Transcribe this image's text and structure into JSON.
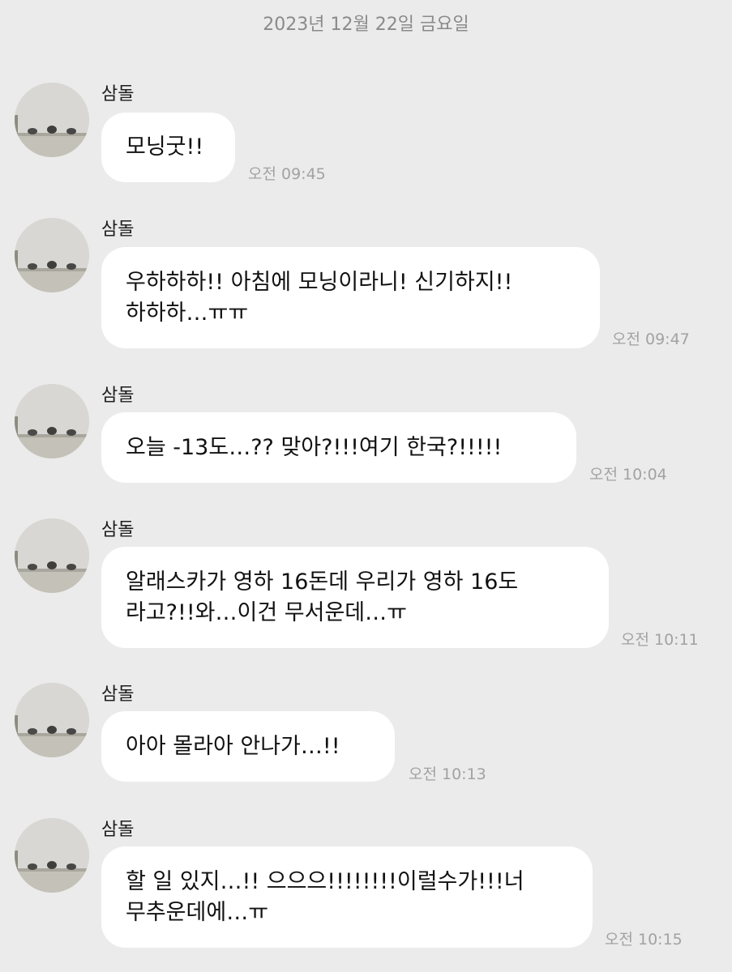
{
  "date_header": "2023년 12월 22일 금요일",
  "sender_name": "삼돌",
  "messages": [
    {
      "text": "모닝굿!!",
      "time": "오전 09:45"
    },
    {
      "text": "우하하하!! 아침에 모닝이라니! 신기하지!!\n하하하…ㅠㅠ",
      "time": "오전 09:47"
    },
    {
      "text": "오늘 -13도…?? 맞아?!!!여기 한국?!!!!!",
      "time": "오전 10:04"
    },
    {
      "text": "알래스카가 영하 16돈데 우리가 영하 16도\n라고?!!와…이건 무서운데…ㅠ",
      "time": "오전 10:11"
    },
    {
      "text": "아아 몰라아 안나가…!!",
      "time": "오전 10:13"
    },
    {
      "text": "할 일 있지…!! 으으으!!!!!!!!이럴수가!!!너\n무추운데에…ㅠ",
      "time": "오전 10:15"
    }
  ]
}
